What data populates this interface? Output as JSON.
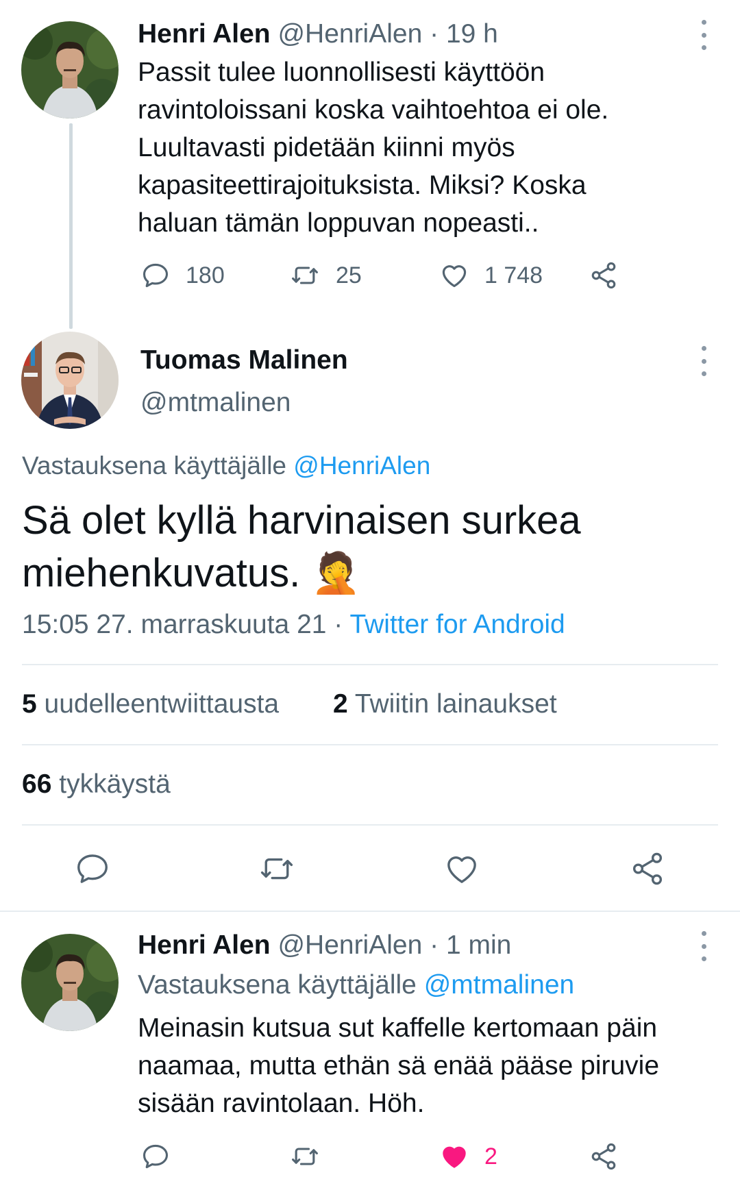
{
  "tweet1": {
    "name": "Henri Alen",
    "handle": "@HenriAlen",
    "separator": "·",
    "time": "19 h",
    "lines": [
      "Passit tulee luonnollisesti käyttöön",
      "ravintoloissani koska vaihtoehtoa ei ole.",
      "Luultavasti pidetään kiinni myös",
      "kapasiteettirajoituksista. Miksi? Koska",
      "haluan tämän loppuvan nopeasti.."
    ],
    "replies": "180",
    "retweets": "25",
    "likes": "1 748"
  },
  "main_tweet": {
    "name": "Tuomas Malinen",
    "handle": "@mtmalinen",
    "reply_prefix": "Vastauksena käyttäjälle",
    "reply_mention": "@HenriAlen",
    "text_line1": "Sä olet kyllä harvinaisen surkea",
    "text_line2": "miehenkuvatus.",
    "emoji": "🤦",
    "timestamp": "15:05 27. marraskuuta 21",
    "separator": "·",
    "source": "Twitter for Android",
    "retweets_count": "5",
    "retweets_label": "uudelleentwiittausta",
    "quotes_count": "2",
    "quotes_label": "Twiitin lainaukset",
    "likes_count": "66",
    "likes_label": "tykkäystä"
  },
  "tweet3": {
    "name": "Henri Alen",
    "handle": "@HenriAlen",
    "separator": "·",
    "time": "1 min",
    "reply_prefix": "Vastauksena käyttäjälle",
    "reply_mention": "@mtmalinen",
    "lines": [
      "Meinasin kutsua sut kaffelle kertomaan päin",
      "naamaa, mutta ethän sä enää pääse piruvie",
      "sisään ravintolaan. Höh."
    ],
    "likes": "2"
  },
  "colors": {
    "text": "#0f1419",
    "muted": "#536471",
    "link": "#1d9bf0",
    "liked": "#f91880",
    "divider": "#e6ecf0"
  }
}
